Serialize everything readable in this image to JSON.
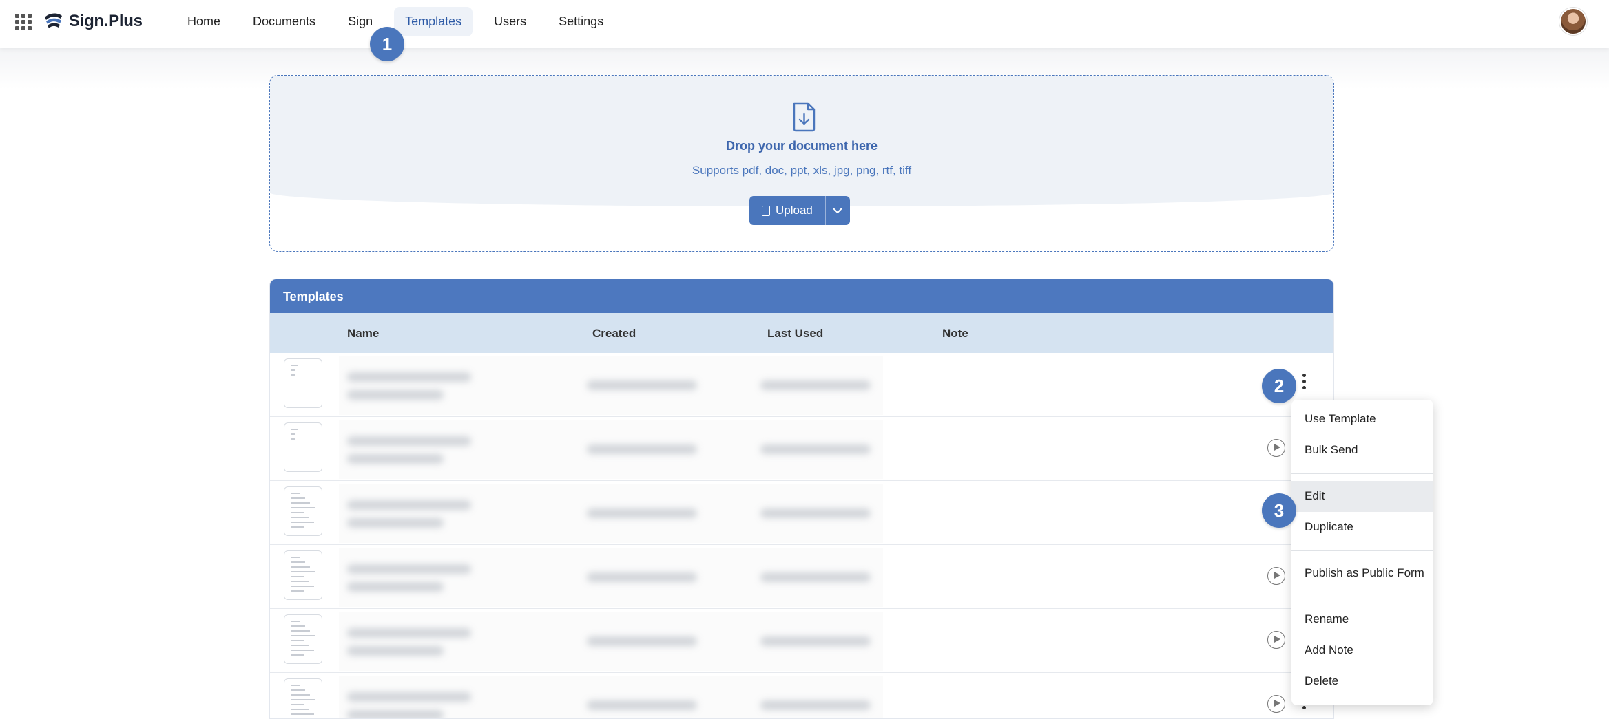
{
  "app": {
    "brand": "Sign.Plus"
  },
  "nav": {
    "items": [
      {
        "label": "Home"
      },
      {
        "label": "Documents"
      },
      {
        "label": "Sign"
      },
      {
        "label": "Templates",
        "active": true
      },
      {
        "label": "Users"
      },
      {
        "label": "Settings"
      }
    ]
  },
  "dropzone": {
    "title": "Drop your document here",
    "subtitle": "Supports pdf, doc, ppt, xls, jpg, png, rtf, tiff",
    "upload_label": "Upload"
  },
  "templates": {
    "title": "Templates",
    "columns": [
      "Name",
      "Created",
      "Last Used",
      "Note"
    ],
    "row_count": 6
  },
  "context_menu": {
    "items": [
      "Use Template",
      "Bulk Send",
      "Edit",
      "Duplicate",
      "Publish as Public Form",
      "Rename",
      "Add Note",
      "Delete"
    ],
    "highlighted": "Edit"
  },
  "step_badges": [
    "1",
    "2",
    "3"
  ],
  "colors": {
    "accent": "#4a76bc",
    "header_bar": "#4d78bf",
    "column_header": "#d5e3f1",
    "dropzone_tint": "#eef2f7"
  },
  "icons": [
    "apps-grid-icon",
    "sign-plus-logo",
    "document-download-icon",
    "file-icon",
    "chevron-down-icon",
    "play-circle-icon",
    "kebab-menu-icon"
  ]
}
